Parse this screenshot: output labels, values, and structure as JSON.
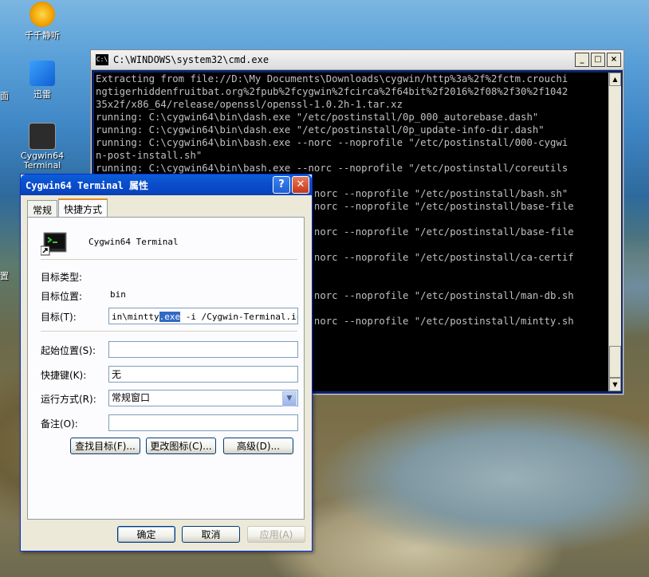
{
  "desktop": {
    "icons": [
      {
        "label": "千千静听"
      },
      {
        "label": "迅雷"
      },
      {
        "label": "Cygwin64\nTerminal"
      }
    ],
    "edge_labels": [
      "面",
      "置"
    ]
  },
  "cmd": {
    "title": "C:\\WINDOWS\\system32\\cmd.exe",
    "icon_text": "C:\\",
    "lines": [
      "Extracting from file://D:\\My Documents\\Downloads\\cygwin/http%3a%2f%2fctm.crouchi",
      "ngtigerhiddenfruitbat.org%2fpub%2fcygwin%2fcirca%2f64bit%2f2016%2f08%2f30%2f1042",
      "35x2f/x86_64/release/openssl/openssl-1.0.2h-1.tar.xz",
      "running: C:\\cygwin64\\bin\\dash.exe \"/etc/postinstall/0p_000_autorebase.dash\"",
      "running: C:\\cygwin64\\bin\\dash.exe \"/etc/postinstall/0p_update-info-dir.dash\"",
      "running: C:\\cygwin64\\bin\\bash.exe --norc --noprofile \"/etc/postinstall/000-cygwi",
      "n-post-install.sh\"",
      "running: C:\\cygwin64\\bin\\bash.exe --norc --noprofile \"/etc/postinstall/coreutils",
      "",
      "                                   --norc --noprofile \"/etc/postinstall/bash.sh\"",
      "                                   --norc --noprofile \"/etc/postinstall/base-file",
      "",
      "                                   --norc --noprofile \"/etc/postinstall/base-file",
      "",
      "                                   --norc --noprofile \"/etc/postinstall/ca-certif",
      "",
      "",
      "                                   --norc --noprofile \"/etc/postinstall/man-db.sh",
      "",
      "                                   --norc --noprofile \"/etc/postinstall/mintty.sh"
    ]
  },
  "dialog": {
    "title": "Cygwin64 Terminal 属性",
    "tabs": [
      "常规",
      "快捷方式"
    ],
    "active_tab": "快捷方式",
    "app_name": "Cygwin64 Terminal",
    "target_type_label": "目标类型:",
    "target_location_label": "目标位置:",
    "target_location_value": "bin",
    "target_label": "目标(T):",
    "target_value_prefix": "in\\mintty",
    "target_value_selected": ".exe",
    "target_value_suffix": " -i /Cygwin-Terminal.ico -",
    "start_in_label": "起始位置(S):",
    "start_in_value": "",
    "hotkey_label": "快捷键(K):",
    "hotkey_value": "无",
    "run_label": "运行方式(R):",
    "run_value": "常规窗口",
    "comment_label": "备注(O):",
    "comment_value": "",
    "find_target_button": "查找目标(F)...",
    "change_icon_button": "更改图标(C)...",
    "advanced_button": "高级(D)...",
    "ok_button": "确定",
    "cancel_button": "取消",
    "apply_button": "应用(A)"
  }
}
